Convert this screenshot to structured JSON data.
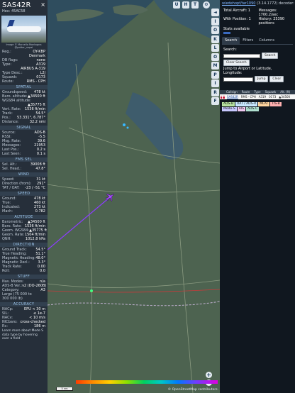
{
  "aircraft": {
    "callsign": "SAS42R",
    "hex": "Hex: 45AC58",
    "photo_credit": "Image © Marcello Montagna\n@potter_nepal",
    "close_icon": "close-icon"
  },
  "registration_rows": [
    {
      "k": "Reg.:",
      "v": "OY-KBP"
    },
    {
      "k": "",
      "v": "Denmark"
    },
    {
      "k": "DB flags:",
      "v": "none"
    },
    {
      "k": "Type:",
      "v": "A319"
    },
    {
      "k": "",
      "v": "AIRBUS A-319"
    },
    {
      "k": "Type Desc.:",
      "v": "L2J"
    },
    {
      "k": "Squawk:",
      "v": "0173"
    },
    {
      "k": "Route:",
      "v": "RMS - CPH"
    }
  ],
  "sections": {
    "spatial": "SPATIAL",
    "signal": "SIGNAL",
    "fms": "FMS SEL",
    "wind": "WIND",
    "speed": "SPEED",
    "altitude": "ALTITUDE",
    "direction": "DIRECTION",
    "stuff": "STUFF",
    "accuracy": "ACCURACY"
  },
  "spatial_rows": [
    {
      "k": "Groundspeed:",
      "v": "478 kt"
    },
    {
      "k": "Baro. altitude:",
      "v": "▲34500 ft"
    },
    {
      "k": "WGS84 altitude:",
      "v": ""
    },
    {
      "k": "",
      "v": "▲35775 ft"
    },
    {
      "k": "Vert. Rate:",
      "v": "1536 ft/min"
    },
    {
      "k": "Track:",
      "v": "54.5°"
    },
    {
      "k": "Pos.:",
      "v": "53.331°, 6.787°"
    },
    {
      "k": "Distance:",
      "v": "32.2 nmi"
    }
  ],
  "signal_rows": [
    {
      "k": "Source:",
      "v": "ADS-B"
    },
    {
      "k": "RSSI:",
      "v": "-5.5"
    },
    {
      "k": "Msg. Rate:",
      "v": "39.6"
    },
    {
      "k": "Messages:",
      "v": "21953"
    },
    {
      "k": "Last Pos.:",
      "v": "0.2 s"
    },
    {
      "k": "Last Seen:",
      "v": "0.1 s"
    }
  ],
  "fms_rows": [
    {
      "k": "Sel. Alt.:",
      "v": "39008 ft"
    },
    {
      "k": "Sel. Head.:",
      "v": "47.8°"
    }
  ],
  "wind_rows": [
    {
      "k": "Speed:",
      "v": "31 kt"
    },
    {
      "k": "Direction (from):",
      "v": "291°"
    },
    {
      "k": "TAT / OAT:",
      "v": "-23 / -51 °C"
    }
  ],
  "speed_rows": [
    {
      "k": "Ground:",
      "v": "478 kt"
    },
    {
      "k": "True:",
      "v": "460 kt"
    },
    {
      "k": "Indicated:",
      "v": "273 kt"
    },
    {
      "k": "Mach:",
      "v": "0.782"
    }
  ],
  "altitude_rows": [
    {
      "k": "Barometric:",
      "v": "▲34500 ft"
    },
    {
      "k": "Baro. Rate:",
      "v": "1536 ft/min"
    },
    {
      "k": "Geom. WGS84:",
      "v": "▲35775 ft"
    },
    {
      "k": "Geom. Rate:",
      "v": "1504 ft/min"
    },
    {
      "k": "QNH:",
      "v": "1012.8 hPa"
    }
  ],
  "direction_rows": [
    {
      "k": "Ground Track:",
      "v": "54.5°"
    },
    {
      "k": "True Heading:",
      "v": "51.1°"
    },
    {
      "k": "Magnetic Heading:",
      "v": "48.0°"
    },
    {
      "k": "Magnetic Decl.:",
      "v": "3.3°"
    },
    {
      "k": "Track Rate:",
      "v": "0.00"
    },
    {
      "k": "Roll:",
      "v": "0.0"
    }
  ],
  "stuff_rows": [
    {
      "k": "Nav. Modes:",
      "v": "n/a"
    },
    {
      "k": "ADS-B Ver.:",
      "v": "v2 (DO-260B)"
    },
    {
      "k": "Category:",
      "v": "A3"
    },
    {
      "k": "Large (75 000 to",
      "v": ""
    },
    {
      "k": "300 000 lb)",
      "v": ""
    }
  ],
  "accuracy_rows": [
    {
      "k": "NACp:",
      "v": "EPU < 30 m"
    },
    {
      "k": "SIL:",
      "v": "≤ 1e-7"
    },
    {
      "k": "NACv:",
      "v": "< 10 m/s"
    },
    {
      "k": "NICbaro:",
      "v": "cross-checked"
    },
    {
      "k": "Rc:",
      "v": "186 m"
    }
  ],
  "footer_note": "Learn more about Mode S data type by hovering over a field",
  "map": {
    "top_buttons": [
      "U",
      "H",
      "T"
    ],
    "settings_icon": "gear-icon",
    "osm_credit": "© OpenStreetMap contributors.",
    "scale_label": "5 nm",
    "zoom_in": "+",
    "zoom_out": "−",
    "alt_labels": [
      "",
      "",
      "",
      "",
      "",
      "",
      ""
    ]
  },
  "vbar_buttons": [
    "◄",
    "I",
    "O",
    "K",
    "L",
    "O",
    "M",
    "P",
    "I",
    "R",
    "F"
  ],
  "right_panel": {
    "version_link": "wiedehopf/tar1090",
    "version_text": "(3.14.1772) decoder:",
    "readsb_link": "readsb",
    "total_label": "Total Aircraft: 1",
    "msgs_label": "Messages:",
    "msgs_value": "1700.2/sec",
    "pos_label": "With Position: 1",
    "history_label": "History: 25390 positions",
    "stats_label": "Stats available",
    "tabs": [
      "Search",
      "Filters",
      "Columns"
    ],
    "search_label": "Search:",
    "search_button": "Search",
    "clear_search": "Clear Search",
    "jump_label": "Jump to Airport or Latitude, Longitude:",
    "jump_button": "Jump",
    "clear_button": "Clear",
    "table_headers": [
      "",
      "Callsign",
      "Route",
      "Type",
      "Squawk",
      "Alt. (ft)"
    ],
    "table_row": [
      "SAS42R",
      "RMS - CPH",
      "A319",
      "0173",
      "▲34500"
    ],
    "legend": [
      {
        "label": "ADS-B",
        "color": "#b8e3a0"
      },
      {
        "label": "UAT / ADS-R",
        "color": "#c8e8ff"
      },
      {
        "label": "MLAT",
        "color": "#ffd6a0"
      },
      {
        "label": "TIS-B",
        "color": "#ffb0b0"
      },
      {
        "label": "Mode-S",
        "color": "#c8c8ff"
      },
      {
        "label": "AIS",
        "color": "#f0c8f0"
      },
      {
        "label": "ADS-C",
        "color": "#b0e0d0"
      }
    ]
  }
}
